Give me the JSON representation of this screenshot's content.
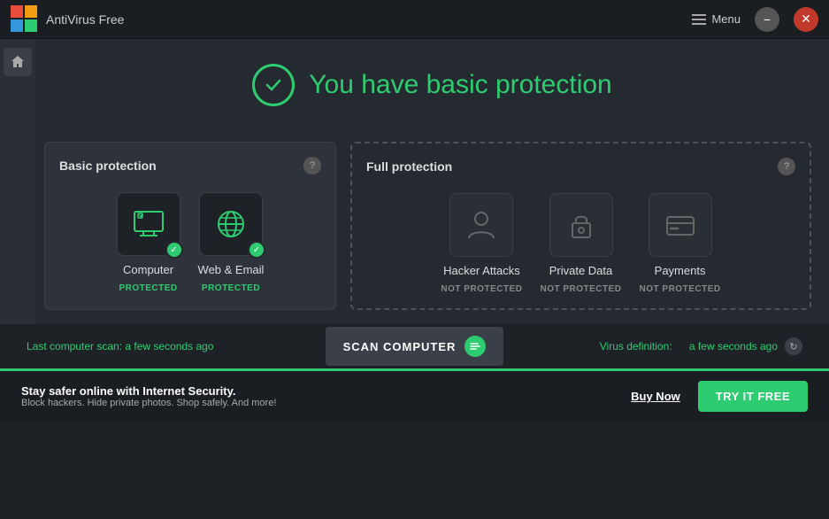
{
  "titlebar": {
    "app_name": "AntiVirus Free",
    "menu_label": "Menu",
    "minimize_symbol": "−",
    "close_symbol": "✕"
  },
  "hero": {
    "title": "You have basic protection"
  },
  "basic_panel": {
    "title": "Basic protection",
    "help_label": "?",
    "items": [
      {
        "label": "Computer",
        "status": "PROTECTED",
        "is_protected": true
      },
      {
        "label": "Web & Email",
        "status": "PROTECTED",
        "is_protected": true
      }
    ]
  },
  "full_panel": {
    "title": "Full protection",
    "help_label": "?",
    "items": [
      {
        "label": "Hacker Attacks",
        "status": "NOT PROTECTED",
        "is_protected": false
      },
      {
        "label": "Private Data",
        "status": "NOT PROTECTED",
        "is_protected": false
      },
      {
        "label": "Payments",
        "status": "NOT PROTECTED",
        "is_protected": false
      }
    ]
  },
  "scan_bar": {
    "last_scan_label": "Last computer scan:",
    "last_scan_time": "a few seconds ago",
    "scan_button_label": "SCAN COMPUTER",
    "virus_def_label": "Virus definition:",
    "virus_def_time": "a few seconds ago"
  },
  "promo_bar": {
    "headline": "Stay safer online with Internet Security.",
    "subtext": "Block hackers. Hide private photos. Shop safely. And more!",
    "buy_label": "Buy Now",
    "try_label": "TRY IT FREE"
  }
}
